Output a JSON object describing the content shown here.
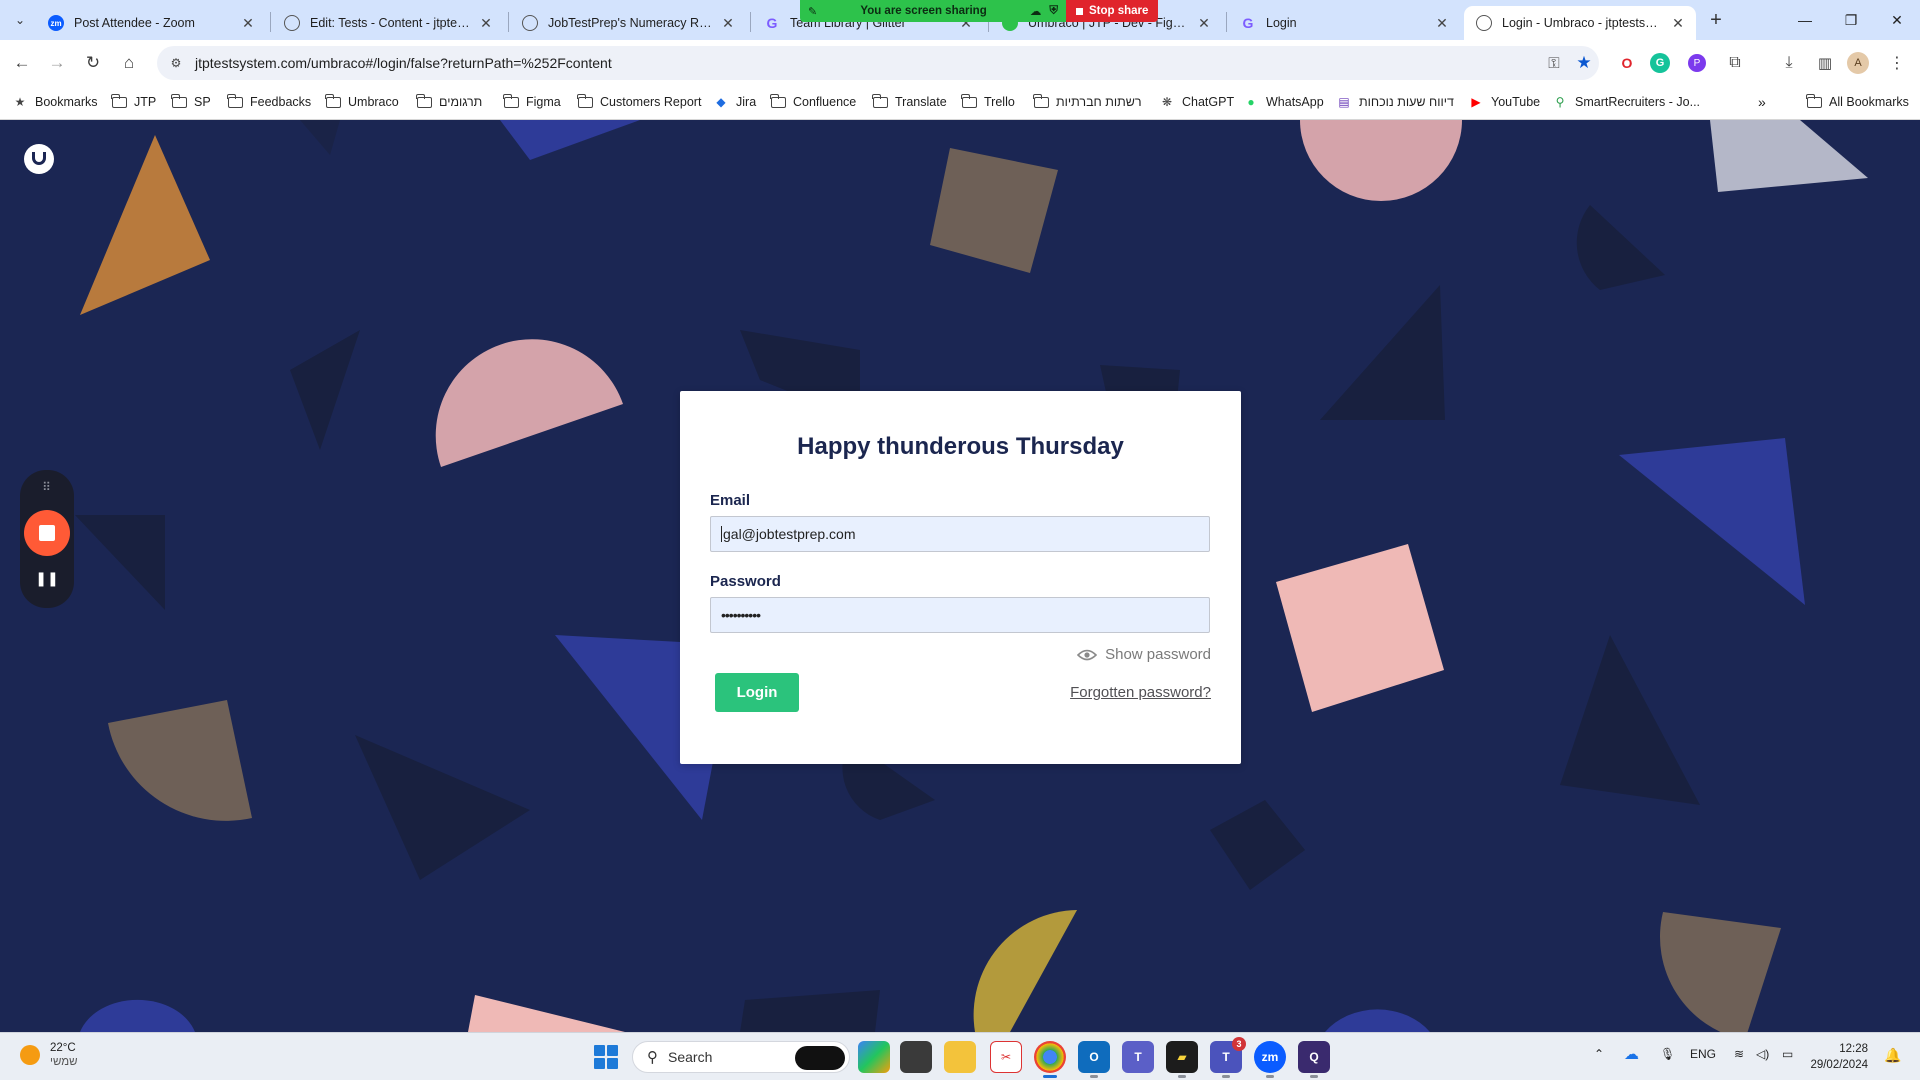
{
  "browser": {
    "tabs": [
      {
        "title": "Post Attendee - Zoom",
        "favicon": "zoom-icon",
        "active": false
      },
      {
        "title": "Edit: Tests - Content - jtptestsys",
        "favicon": "globe-icon",
        "active": false
      },
      {
        "title": "JobTestPrep's Numeracy Review",
        "favicon": "globe-icon",
        "active": false
      },
      {
        "title": "Team Library | Glitter",
        "favicon": "glitter-icon",
        "active": false
      },
      {
        "title": "Umbraco | JTP - Dev - Figma",
        "favicon": "figma-icon",
        "active": false
      },
      {
        "title": "Login",
        "favicon": "glitter-icon",
        "active": false
      },
      {
        "title": "Login - Umbraco - jtptestsystem",
        "favicon": "globe-icon",
        "active": true
      }
    ],
    "url": "jtptestsystem.com/umbraco#/login/false?returnPath=%252Fcontent",
    "bookmarks": [
      {
        "label": "Bookmarks",
        "icon": "star-icon"
      },
      {
        "label": "JTP",
        "icon": "folder-icon"
      },
      {
        "label": "SP",
        "icon": "folder-icon"
      },
      {
        "label": "Feedbacks",
        "icon": "folder-icon"
      },
      {
        "label": "Umbraco",
        "icon": "folder-icon"
      },
      {
        "label": "תרגומים",
        "icon": "folder-icon"
      },
      {
        "label": "Figma",
        "icon": "folder-icon"
      },
      {
        "label": "Customers Report",
        "icon": "folder-icon"
      },
      {
        "label": "Jira",
        "icon": "jira-icon"
      },
      {
        "label": "Confluence",
        "icon": "folder-icon"
      },
      {
        "label": "Translate",
        "icon": "folder-icon"
      },
      {
        "label": "Trello",
        "icon": "folder-icon"
      },
      {
        "label": "רשתות חברתיות",
        "icon": "folder-icon"
      },
      {
        "label": "ChatGPT",
        "icon": "chatgpt-icon"
      },
      {
        "label": "WhatsApp",
        "icon": "whatsapp-icon"
      },
      {
        "label": "דיווח שעות נוכחות",
        "icon": "sheet-icon"
      },
      {
        "label": "YouTube",
        "icon": "youtube-icon"
      },
      {
        "label": "SmartRecruiters - Jo...",
        "icon": "smartrecruiters-icon"
      }
    ],
    "all_bookmarks": "All Bookmarks"
  },
  "screen_share": {
    "status": "You are screen sharing",
    "stop": "Stop share"
  },
  "login": {
    "greeting": "Happy thunderous Thursday",
    "email_label": "Email",
    "email_value": "gal@jobtestprep.com",
    "password_label": "Password",
    "password_value": "••••••••••",
    "show_password": "Show password",
    "login_button": "Login",
    "forgot_link": "Forgotten password?"
  },
  "taskbar": {
    "weather_temp": "22°C",
    "weather_desc": "שמשי",
    "search_placeholder": "Search",
    "teams_badge": "3",
    "language": "ENG",
    "time": "12:28",
    "date": "29/02/2024"
  },
  "colors": {
    "page_bg": "#1b2653",
    "tabstrip_bg": "#d3e3fd",
    "login_button": "#2bc37c",
    "heading": "#1b264f",
    "share_green": "#2dc24b",
    "share_red": "#e0242c"
  }
}
